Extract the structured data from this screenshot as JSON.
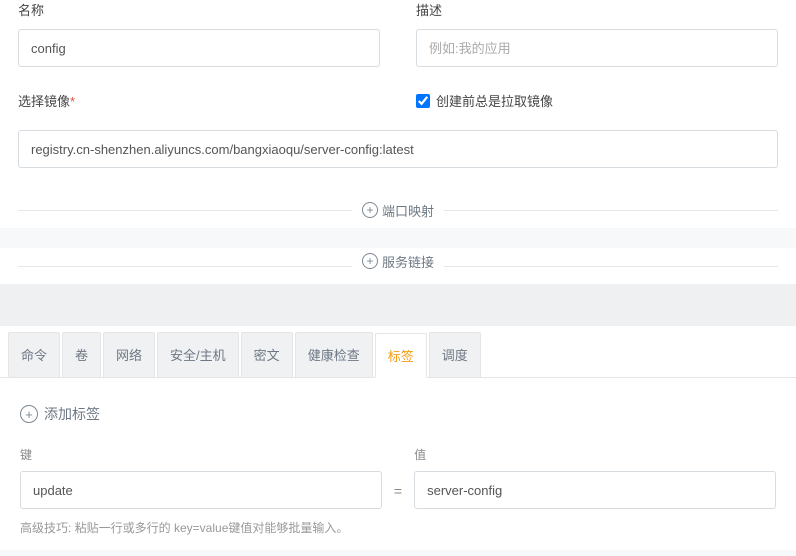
{
  "top": {
    "name_label": "名称",
    "name_value": "config",
    "desc_label": "描述",
    "desc_placeholder": "例如:我的应用",
    "image_label": "选择镜像",
    "checkbox_label": "创建前总是拉取镜像",
    "checkbox_checked": true,
    "image_value": "registry.cn-shenzhen.aliyuncs.com/bangxiaoqu/server-config:latest",
    "expand_port": "端口映射",
    "expand_link": "服务链接"
  },
  "tabs": [
    {
      "label": "命令",
      "active": false
    },
    {
      "label": "卷",
      "active": false
    },
    {
      "label": "网络",
      "active": false
    },
    {
      "label": "安全/主机",
      "active": false
    },
    {
      "label": "密文",
      "active": false
    },
    {
      "label": "健康检查",
      "active": false
    },
    {
      "label": "标签",
      "active": true
    },
    {
      "label": "调度",
      "active": false
    }
  ],
  "bottom": {
    "add_label": "添加标签",
    "key_label": "键",
    "value_label": "值",
    "eq": "=",
    "key_value": "update",
    "val_value": "server-config",
    "hint": "高级技巧: 粘贴一行或多行的 key=value键值对能够批量输入。"
  }
}
